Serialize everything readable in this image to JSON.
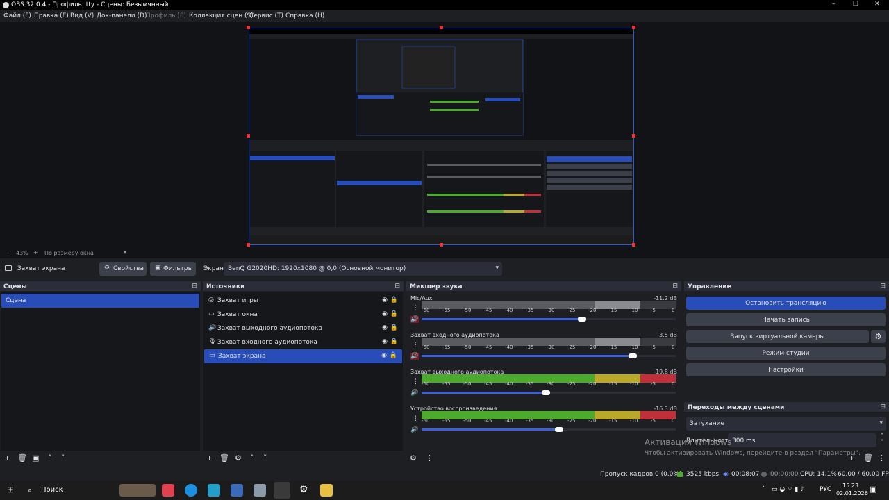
{
  "window": {
    "title": "OBS 32.0.4 - Профиль: tty - Сцены: Безымянный",
    "minimize": "–",
    "maximize": "❐",
    "close": "✕"
  },
  "menu": [
    {
      "label": "Файл (F)",
      "enabled": true
    },
    {
      "label": "Правка (E)",
      "enabled": true
    },
    {
      "label": "Вид (V)",
      "enabled": true
    },
    {
      "label": "Док-панели (D)",
      "enabled": true
    },
    {
      "label": "Профиль (P)",
      "enabled": false
    },
    {
      "label": "Коллекция сцен (S)",
      "enabled": true
    },
    {
      "label": "Сервис (T)",
      "enabled": true
    },
    {
      "label": "Справка (H)",
      "enabled": true
    }
  ],
  "zoom": {
    "minus": "−",
    "value": "43%",
    "plus": "+",
    "mode": "По размеру окна"
  },
  "source_bar": {
    "source_name": "Захват экрана",
    "properties": "Свойства",
    "filters": "Фильтры",
    "screen_label": "Экран",
    "screen_value": "BenQ G2020HD: 1920x1080 @ 0,0 (Основной монитор)"
  },
  "scenes": {
    "title": "Сцены",
    "items": [
      "Сцена"
    ]
  },
  "sources": {
    "title": "Источники",
    "items": [
      {
        "label": "Захват игры",
        "icon": "gamepad-icon"
      },
      {
        "label": "Захват окна",
        "icon": "window-icon"
      },
      {
        "label": "Захват выходного аудиопотока",
        "icon": "speaker-icon"
      },
      {
        "label": "Захват входного аудиопотока",
        "icon": "microphone-icon"
      },
      {
        "label": "Захват экрана",
        "icon": "monitor-icon"
      }
    ]
  },
  "mixer": {
    "title": "Микшер звука",
    "ticks": [
      "-60",
      "-55",
      "-50",
      "-45",
      "-40",
      "-35",
      "-30",
      "-25",
      "-20",
      "-15",
      "-10",
      "-5",
      "0"
    ],
    "channels": [
      {
        "name": "Mic/Aux",
        "db": "-11.2 dB",
        "muted": true,
        "volume": 0.63
      },
      {
        "name": "Захват входного аудиопотока",
        "db": "-3.5 dB",
        "muted": true,
        "volume": 0.83
      },
      {
        "name": "Захват выходного аудиопотока",
        "db": "-19.8 dB",
        "muted": false,
        "volume": 0.49
      },
      {
        "name": "Устройство воспроизведения",
        "db": "-16.3 dB",
        "muted": false,
        "volume": 0.54
      }
    ]
  },
  "controls": {
    "title": "Управление",
    "buttons": [
      "Остановить трансляцию",
      "Начать запись",
      "Запуск виртуальной камеры",
      "Режим студии",
      "Настройки"
    ]
  },
  "transitions": {
    "title": "Переходы между сценами",
    "selected": "Затухание",
    "duration_label": "Длительность",
    "duration_value": "300 ms"
  },
  "watermark": {
    "title": "Активация Windows",
    "subtitle": "Чтобы активировать Windows, перейдите в раздел \"Параметры\"."
  },
  "status": {
    "dropped": "Пропуск кадров 0 (0.0%)",
    "bitrate": "3525 kbps",
    "stream_time": "00:08:07",
    "record_time": "00:00:00",
    "cpu": "CPU: 14.1%",
    "fps": "60.00 / 60.00 FPS"
  },
  "taskbar": {
    "search": "Поиск",
    "lang": "РУС",
    "time": "15:23",
    "date": "02.01.2026"
  },
  "colors": {
    "accent": "#284cb8",
    "meter_green": "#4caa2c",
    "meter_yellow": "#b9a82a",
    "meter_red": "#c0303a",
    "meter_gray": "#5a5b60"
  }
}
